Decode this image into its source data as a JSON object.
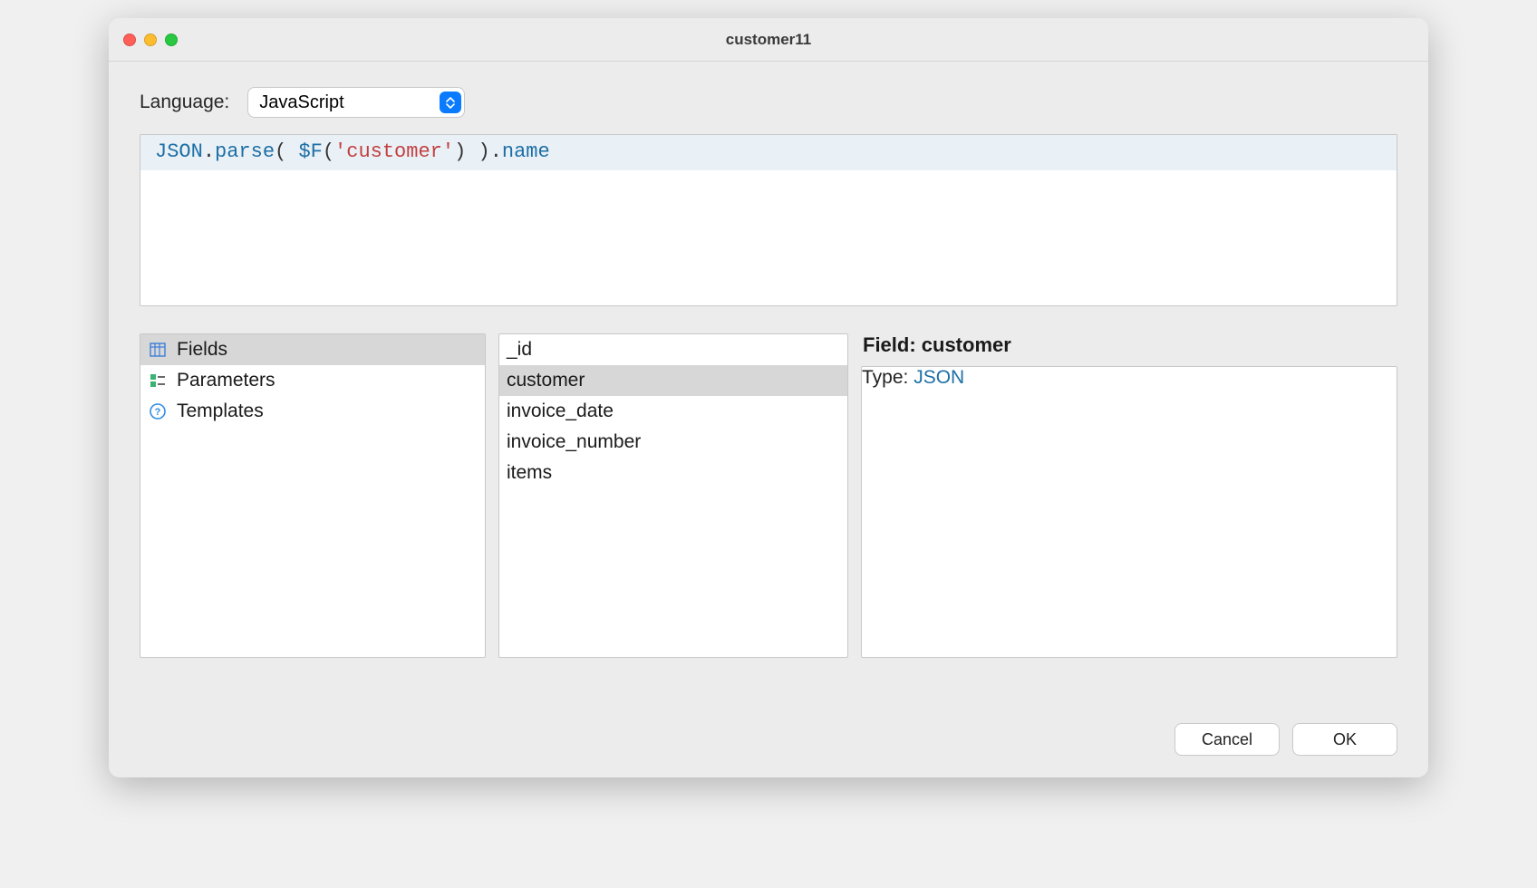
{
  "window": {
    "title": "customer11"
  },
  "language": {
    "label": "Language:",
    "selected": "JavaScript",
    "options": [
      "JavaScript"
    ]
  },
  "editor": {
    "tokens": {
      "json": "JSON",
      "dot1": ".",
      "parse": "parse",
      "open1": "( ",
      "fn": "$F",
      "open2": "(",
      "str": "'customer'",
      "close2": ")",
      "close1": " )",
      "dot2": ".",
      "name": "name"
    }
  },
  "categories": {
    "items": [
      {
        "label": "Fields",
        "icon": "fields-icon",
        "selected": true
      },
      {
        "label": "Parameters",
        "icon": "parameters-icon",
        "selected": false
      },
      {
        "label": "Templates",
        "icon": "templates-icon",
        "selected": false
      }
    ]
  },
  "fields": {
    "items": [
      {
        "label": "_id",
        "selected": false
      },
      {
        "label": "customer",
        "selected": true
      },
      {
        "label": "invoice_date",
        "selected": false
      },
      {
        "label": "invoice_number",
        "selected": false
      },
      {
        "label": "items",
        "selected": false
      }
    ]
  },
  "detail": {
    "header": "Field: customer",
    "type_label": "Type: ",
    "type_value": "JSON"
  },
  "footer": {
    "cancel": "Cancel",
    "ok": "OK"
  }
}
